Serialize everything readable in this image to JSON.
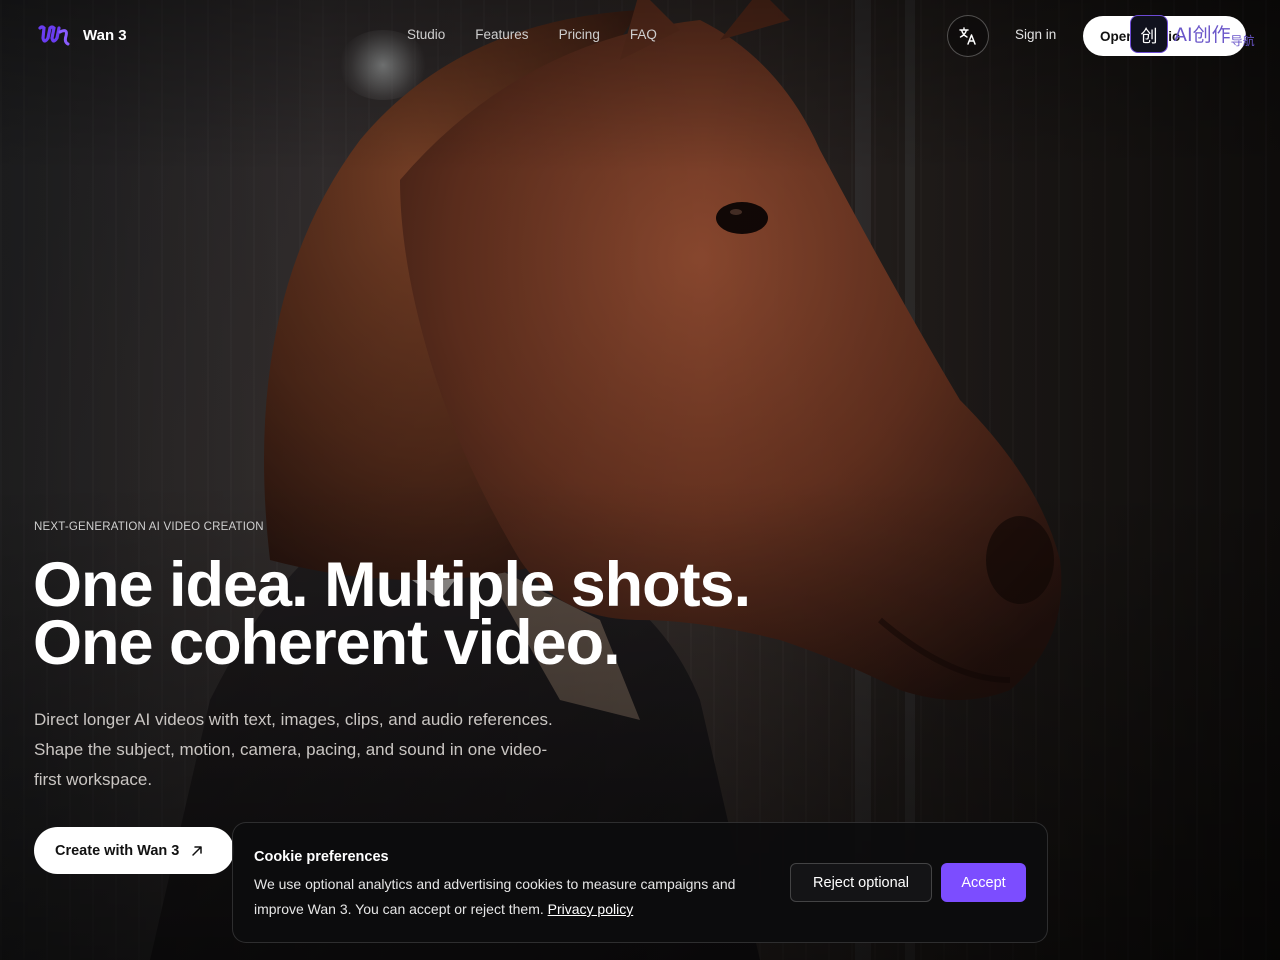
{
  "header": {
    "brand": "Wan 3",
    "logo_icon": "wan-logo-icon",
    "nav": [
      "Studio",
      "Features",
      "Pricing",
      "FAQ"
    ],
    "language_icon": "translate-icon",
    "sign_in": "Sign in",
    "open_studio": "Open Studio"
  },
  "overlay_badge": {
    "icon_glyph": "创",
    "text": "AI创作",
    "sub": "导航"
  },
  "hero": {
    "eyebrow": "NEXT-GENERATION AI VIDEO CREATION",
    "headline_line1": "One idea. Multiple shots.",
    "headline_line2": "One coherent video.",
    "subtext": "Direct longer AI videos with text, images, clips, and audio references. Shape the subject, motion, camera, pacing, and sound in one video-first workspace.",
    "cta_label": "Create with Wan 3",
    "cta_icon": "arrow-up-right-icon"
  },
  "cookie_banner": {
    "title": "Cookie preferences",
    "body": "We use optional analytics and advertising cookies to measure campaigns and improve Wan 3. You can accept or reject them.",
    "privacy_link": "Privacy policy",
    "reject_label": "Reject optional",
    "accept_label": "Accept"
  },
  "colors": {
    "accent": "#7c4dff",
    "logo": "#6a3df0",
    "cookie_bg": "#0c0c0e"
  }
}
